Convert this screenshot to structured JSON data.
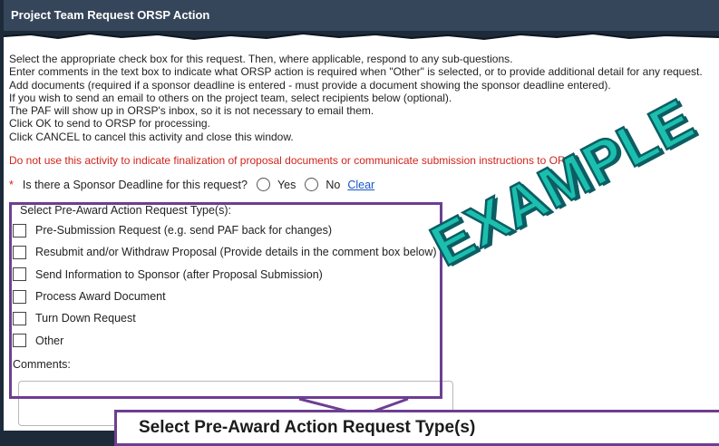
{
  "window": {
    "title": "Project Team Request ORSP Action"
  },
  "instructions": [
    "Select the appropriate check box for this request. Then, where applicable, respond to any sub-questions.",
    "Enter comments in the text box to indicate what ORSP action is required when \"Other\" is selected, or to provide additional detail for any request.",
    "Add documents (required if a sponsor deadline is entered - must provide a document showing the sponsor deadline entered).",
    "If you wish to send an email to others on the project team, select recipients below (optional).",
    "The PAF will show up in ORSP's inbox, so it is not necessary to email them.",
    "Click OK to send to ORSP for processing.",
    "Click CANCEL to cancel this activity and close this window."
  ],
  "warning": "Do not use this activity to indicate finalization of proposal documents or communicate submission instructions to ORSP.",
  "deadline": {
    "required_marker": "*",
    "question": "Is there a Sponsor Deadline for this request?",
    "yes_label": "Yes",
    "no_label": "No",
    "clear_label": "Clear"
  },
  "request_types": {
    "title": "Select Pre-Award Action Request Type(s):",
    "options": [
      "Pre-Submission Request (e.g. send PAF back for changes)",
      "Resubmit and/or Withdraw Proposal (Provide details in the comment box below)",
      "Send Information to Sponsor (after Proposal Submission)",
      "Process Award Document",
      "Turn Down Request",
      "Other"
    ]
  },
  "comments": {
    "label": "Comments:",
    "value": ""
  },
  "callout": {
    "text": "Select Pre-Award Action Request Type(s)"
  },
  "watermark": "EXAMPLE",
  "colors": {
    "titlebar": "#36465a",
    "highlight_border": "#6d3e92",
    "warning_text": "#d0241c",
    "watermark": "#1bbfae"
  }
}
